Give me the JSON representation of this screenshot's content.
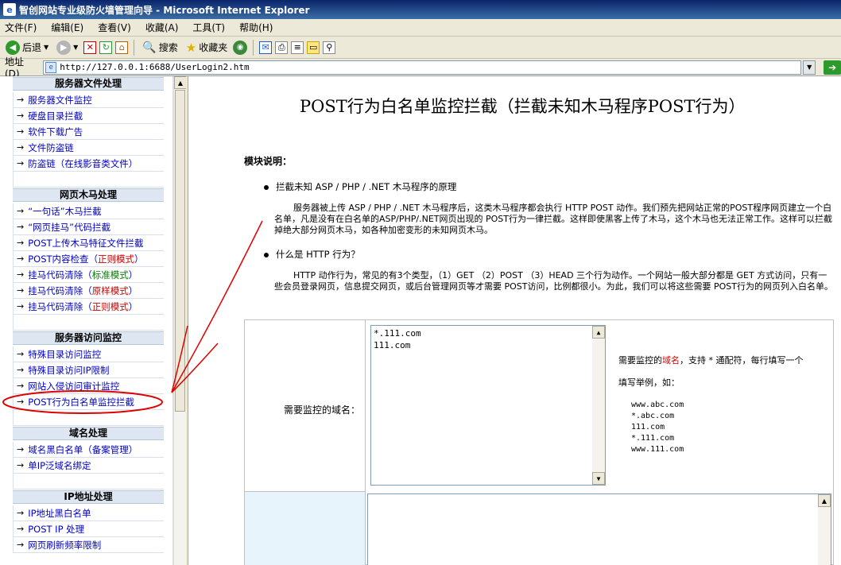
{
  "window": {
    "title": "智创网站专业级防火墙管理向导 - Microsoft Internet Explorer"
  },
  "menu": [
    "文件(F)",
    "编辑(E)",
    "查看(V)",
    "收藏(A)",
    "工具(T)",
    "帮助(H)"
  ],
  "toolbar": {
    "back": "后退",
    "search": "搜索",
    "favorites": "收藏夹"
  },
  "address": {
    "label": "地址(D)",
    "url": "http://127.0.0.1:6688/UserLogin2.htm"
  },
  "sidebar": {
    "s1": {
      "title": "服务器文件处理",
      "items": [
        "服务器文件监控",
        "硬盘目录拦截",
        "软件下载广告",
        "文件防盗链",
        "防盗链（在线影音类文件）"
      ]
    },
    "s2": {
      "title": "网页木马处理",
      "items": [
        "“一句话”木马拦截",
        "“网页挂马”代码拦截",
        "POST上传木马特征文件拦截",
        "POST内容检查（",
        "挂马代码清除（",
        "挂马代码清除（",
        "挂马代码清除（"
      ],
      "mode_regex": "正则模式",
      "mode_standard": "标准模式",
      "mode_original": "原样模式",
      "mode_close": "）"
    },
    "s3": {
      "title": "服务器访问监控",
      "items": [
        "特殊目录访问监控",
        "特殊目录访问IP限制",
        "网站入侵访问审计监控",
        "POST行为白名单监控拦截"
      ]
    },
    "s4": {
      "title": "域名处理",
      "items": [
        "域名黑白名单（备案管理）",
        "单IP泛域名绑定"
      ]
    },
    "s5": {
      "title": "IP地址处理",
      "items": [
        "IP地址黑白名单",
        "POST IP 处理",
        "网页刷新频率限制"
      ]
    },
    "arrow": "→"
  },
  "main": {
    "title": "POST行为白名单监控拦截（拦截未知木马程序POST行为）",
    "module_label": "模块说明：",
    "bullet1": "拦截未知 ASP / PHP / .NET 木马程序的原理",
    "para1": "服务器被上传 ASP / PHP / .NET 木马程序后，这类木马程序都会执行 HTTP POST 动作。我们预先把网站正常的POST程序网页建立一个白名单，凡是没有在白名单的ASP/PHP/.NET网页出现的 POST行为一律拦截。这样即使黑客上传了木马，这个木马也无法正常工作。这样可以拦截掉绝大部分网页木马，如各种加密变形的未知网页木马。",
    "bullet2": "什么是 HTTP 行为？",
    "para2": "HTTP 动作行为，常见的有3个类型，（1）GET （2）POST （3）HEAD 三个行为动作。一个网站一般大部分都是 GET 方式访问，只有一些会员登录网页，信息提交网页，或后台管理网页等才需要 POST访问，比例都很小。为此，我们可以将这些需要 POST行为的网页列入白名单。",
    "config": {
      "label": "需要监控的域名：",
      "domains": [
        "*.111.com",
        "111.com"
      ],
      "help_pre": "需要监控的",
      "help_hl": "域名",
      "help_post": "，支持 * 通配符，每行填写一个",
      "help2": "填写举例，如：",
      "examples": [
        "www.abc.com",
        "*.abc.com",
        "111.com",
        "*.111.com",
        "www.111.com"
      ]
    }
  },
  "colors": {
    "annotation": "#e00000",
    "link": "#0000cc"
  }
}
